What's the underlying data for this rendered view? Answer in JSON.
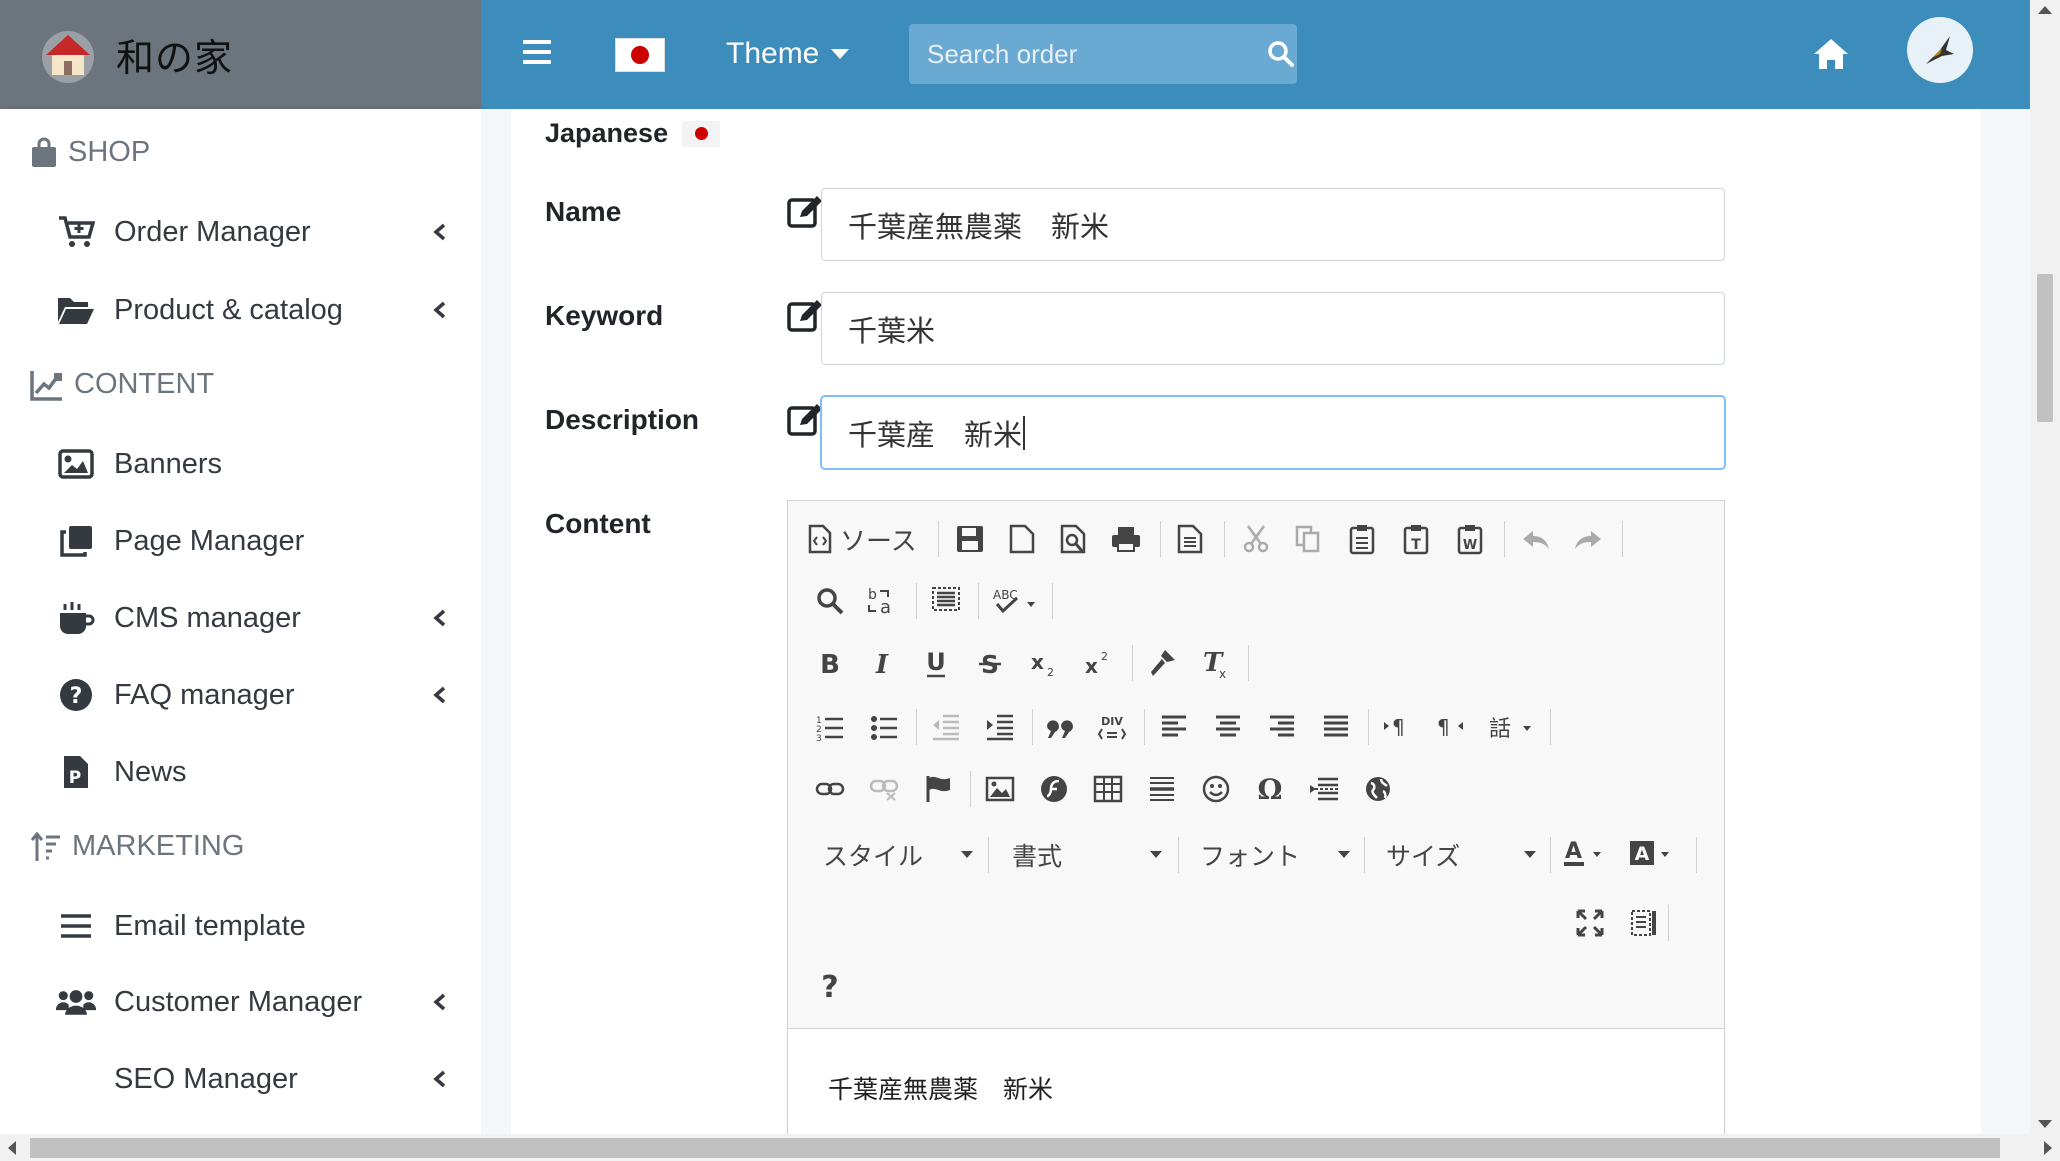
{
  "header": {
    "brand_name": "和の家",
    "theme_label": "Theme",
    "search_placeholder": "Search order",
    "colors": {
      "navbar": "#3c8dbc",
      "brand_bg": "#6c757d"
    }
  },
  "sidebar": {
    "sections": [
      {
        "title": "SHOP",
        "icon": "shopping-bag-icon"
      },
      {
        "title": "CONTENT",
        "icon": "chart-edit-icon"
      },
      {
        "title": "MARKETING",
        "icon": "sort-amount-icon"
      }
    ],
    "items": [
      {
        "label": "Order Manager",
        "icon": "cart-plus-icon",
        "expandable": true
      },
      {
        "label": "Product & catalog",
        "icon": "folder-open-icon",
        "expandable": true
      },
      {
        "label": "Banners",
        "icon": "image-icon",
        "expandable": false
      },
      {
        "label": "Page Manager",
        "icon": "clone-icon",
        "expandable": false
      },
      {
        "label": "CMS manager",
        "icon": "coffee-icon",
        "expandable": true
      },
      {
        "label": "FAQ manager",
        "icon": "question-circle-icon",
        "expandable": true
      },
      {
        "label": "News",
        "icon": "file-powerpoint-icon",
        "expandable": false
      },
      {
        "label": "Email template",
        "icon": "bars-icon",
        "expandable": false
      },
      {
        "label": "Customer Manager",
        "icon": "users-icon",
        "expandable": true
      },
      {
        "label": "SEO Manager",
        "icon": "",
        "expandable": true
      }
    ]
  },
  "form": {
    "language": "Japanese",
    "fields": [
      {
        "label": "Name",
        "value": "千葉産無農薬　新米"
      },
      {
        "label": "Keyword",
        "value": "千葉米"
      },
      {
        "label": "Description",
        "value": "千葉産　新米",
        "focused": true
      }
    ],
    "content_label": "Content",
    "editor": {
      "source_label": "ソース",
      "combos": [
        "スタイル",
        "書式",
        "フォント",
        "サイズ"
      ],
      "help_label": "?",
      "body_text": "千葉産無農薬　新米"
    }
  }
}
